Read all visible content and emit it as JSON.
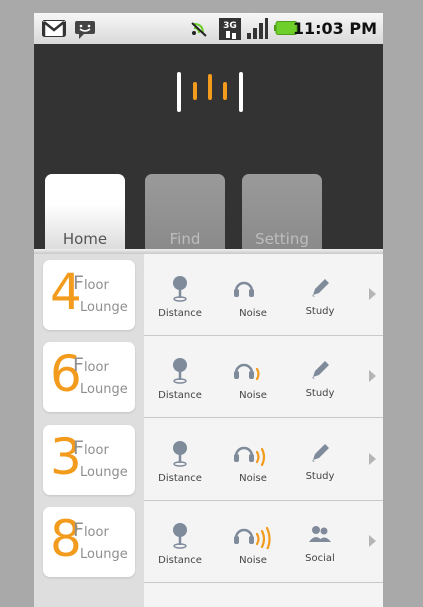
{
  "status_bar": {
    "time": "11:03 PM",
    "network": "3G",
    "icons": [
      "gmail-icon",
      "messaging-icon",
      "wifi-icon",
      "3g-icon",
      "signal-icon",
      "battery-icon"
    ],
    "battery_color": "#6fcf2a"
  },
  "tabs": [
    {
      "label": "Home",
      "active": true
    },
    {
      "label": "Find",
      "active": false
    },
    {
      "label": "Setting",
      "active": false
    }
  ],
  "floors": [
    {
      "number": "4",
      "floor_label": "Floor",
      "lounge_label": "Lounge",
      "distance_label": "Distance",
      "noise_label": "Noise",
      "noise_level": 0,
      "activity_label": "Study",
      "activity_icon": "pencil-icon"
    },
    {
      "number": "6",
      "floor_label": "Floor",
      "lounge_label": "Lounge",
      "distance_label": "Distance",
      "noise_label": "Noise",
      "noise_level": 1,
      "activity_label": "Study",
      "activity_icon": "pencil-icon"
    },
    {
      "number": "3",
      "floor_label": "Floor",
      "lounge_label": "Lounge",
      "distance_label": "Distance",
      "noise_label": "Noise",
      "noise_level": 2,
      "activity_label": "Study",
      "activity_icon": "pencil-icon"
    },
    {
      "number": "8",
      "floor_label": "Floor",
      "lounge_label": "Lounge",
      "distance_label": "Distance",
      "noise_label": "Noise",
      "noise_level": 3,
      "activity_label": "Social",
      "activity_icon": "people-icon"
    }
  ],
  "colors": {
    "accent": "#f39b1d",
    "icon_gray": "#7f8a9a",
    "header_bg": "#333333"
  }
}
